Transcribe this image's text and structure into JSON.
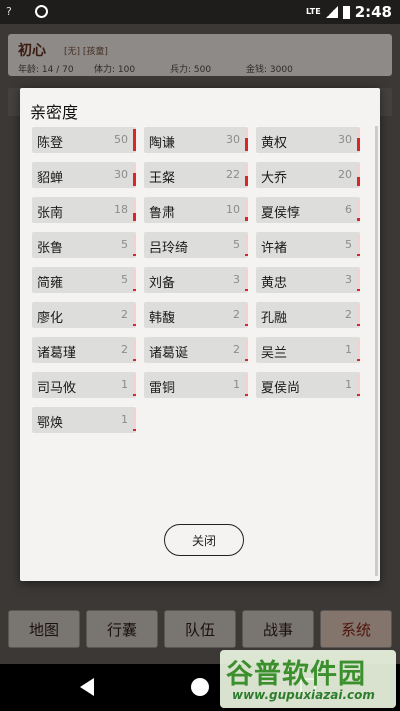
{
  "status_bar": {
    "network": "LTE",
    "time": "2:48",
    "wifi_label": "?"
  },
  "hero": {
    "name": "初心",
    "tags": "[无] [孩童]",
    "stats": [
      {
        "label": "年龄:",
        "value": "14 / 70"
      },
      {
        "label": "体力:",
        "value": "100"
      },
      {
        "label": "兵力:",
        "value": "500"
      },
      {
        "label": "金钱:",
        "value": "3000"
      }
    ]
  },
  "bottom_nav": {
    "items": [
      {
        "label": "地图"
      },
      {
        "label": "行囊"
      },
      {
        "label": "队伍"
      },
      {
        "label": "战事"
      },
      {
        "label": "系统",
        "active": true
      }
    ]
  },
  "intimacy": {
    "title": "亲密度",
    "close_label": "关闭",
    "max_value": 50,
    "accent": "#d9262a",
    "people": [
      {
        "name": "陈登",
        "value": 50
      },
      {
        "name": "陶谦",
        "value": 30
      },
      {
        "name": "黄权",
        "value": 30
      },
      {
        "name": "貂蝉",
        "value": 30
      },
      {
        "name": "王粲",
        "value": 22
      },
      {
        "name": "大乔",
        "value": 20
      },
      {
        "name": "张南",
        "value": 18
      },
      {
        "name": "鲁肃",
        "value": 10
      },
      {
        "name": "夏侯惇",
        "value": 6
      },
      {
        "name": "张鲁",
        "value": 5
      },
      {
        "name": "吕玲绮",
        "value": 5
      },
      {
        "name": "许褚",
        "value": 5
      },
      {
        "name": "简雍",
        "value": 5
      },
      {
        "name": "刘备",
        "value": 3
      },
      {
        "name": "黄忠",
        "value": 3
      },
      {
        "name": "廖化",
        "value": 2
      },
      {
        "name": "韩馥",
        "value": 2
      },
      {
        "name": "孔融",
        "value": 2
      },
      {
        "name": "诸葛瑾",
        "value": 2
      },
      {
        "name": "诸葛诞",
        "value": 2
      },
      {
        "name": "吴兰",
        "value": 1
      },
      {
        "name": "司马攸",
        "value": 1
      },
      {
        "name": "雷铜",
        "value": 1
      },
      {
        "name": "夏侯尚",
        "value": 1
      },
      {
        "name": "鄂焕",
        "value": 1
      }
    ]
  },
  "watermark": {
    "logo": "谷普软件园",
    "url": "www.gupuxiazai.com"
  }
}
